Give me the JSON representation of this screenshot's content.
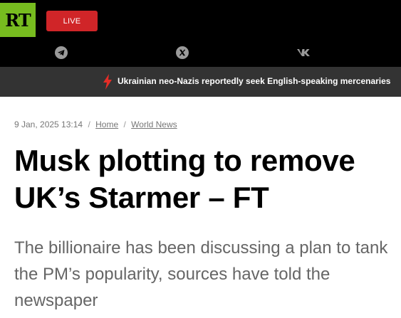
{
  "header": {
    "logo_text": "RT",
    "live_label": "LIVE",
    "social_icons": [
      "telegram-icon",
      "x-icon",
      "vk-icon"
    ]
  },
  "ticker": {
    "headline": "Ukrainian neo-Nazis reportedly seek English-speaking mercenaries"
  },
  "breadcrumb": {
    "date": "9 Jan, 2025 13:14",
    "separator": "/",
    "home": "Home",
    "section": "World News"
  },
  "article": {
    "title": "Musk plotting to remove UK’s Starmer – FT",
    "summary": "The billionaire has been discussing a plan to tank the PM’s popularity, sources have told the newspaper"
  },
  "colors": {
    "brand_green": "#77bc1f",
    "live_red": "#d02528",
    "ticker_bg": "#333333",
    "bolt_red": "#e52d27"
  }
}
